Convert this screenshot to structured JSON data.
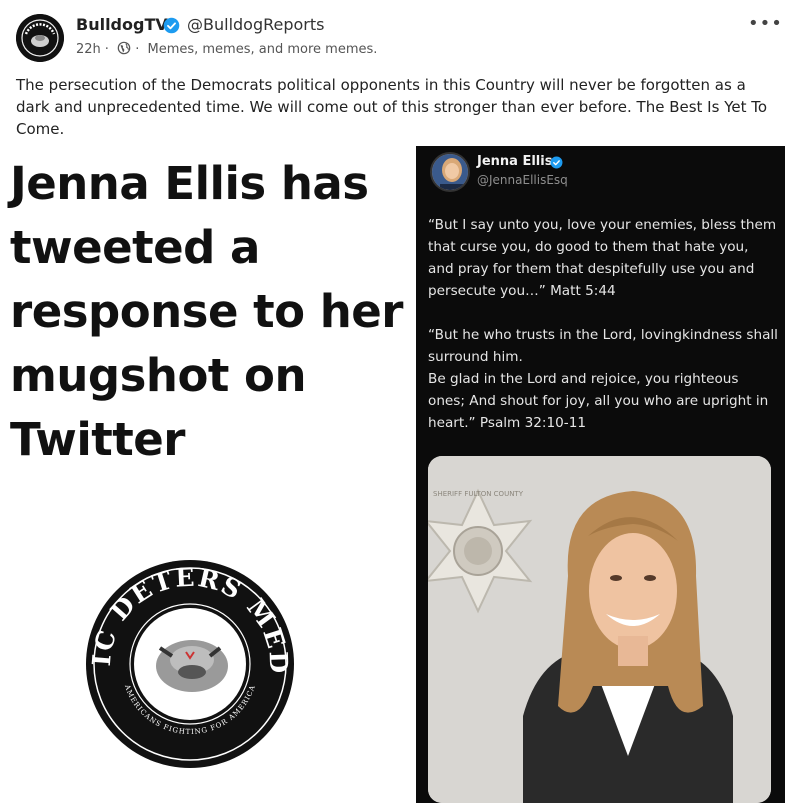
{
  "post": {
    "author_name": "BulldogTV",
    "handle": "@BulldogReports",
    "time": "22h",
    "dot": "·",
    "group": "Memes, memes, and more memes.",
    "text": "The persecution of the Democrats political opponents in this Country will never be forgotten as a dark and unprecedented time. We will come out of this stronger than ever before. The Best Is Yet To Come.",
    "more_label": "•••"
  },
  "image": {
    "headline": "Jenna Ellis has tweeted a response to her mugshot on Twitter",
    "logo_text_top": "ERIC DETERS MEDIA",
    "logo_text_bottom": "AMERICANS FIGHTING FOR AMERICA",
    "tweet": {
      "name": "Jenna Ellis",
      "handle": "@JennaEllisEsq",
      "paragraph1": "“But I say unto you, love your enemies, bless them that curse you, do good to them that hate you, and pray for them that despitefully use you and persecute you…” Matt 5:44",
      "paragraph2": "“But he who trusts in the Lord, lovingkindness shall surround him.\nBe glad in the Lord and rejoice, you righteous ones; And shout for joy, all you who are upright in heart.” Psalm 32:10-11"
    },
    "badge_text": "SHERIFF FULTON COUNTY"
  },
  "colors": {
    "verified": "#1d9bf0",
    "tweet_bg": "#0b0b0b",
    "headline": "#111111"
  },
  "icons": {
    "verified": "verified-check-icon",
    "globe": "globe-icon",
    "more": "more-horizontal-icon"
  }
}
